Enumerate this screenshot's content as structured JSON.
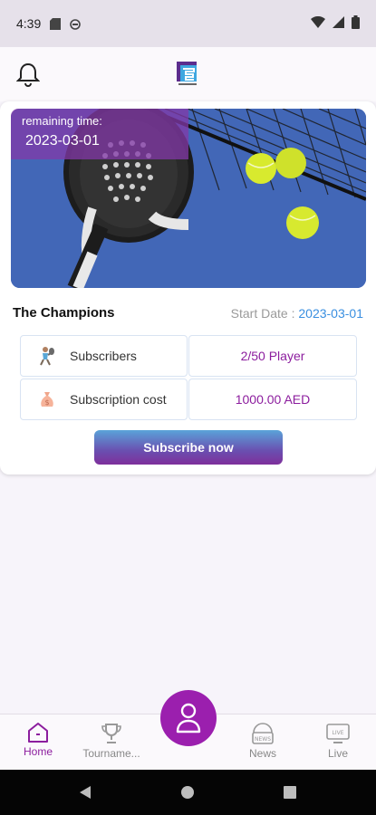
{
  "status_bar": {
    "time": "4:39"
  },
  "card": {
    "remaining_label": "remaining time:",
    "remaining_date": "2023-03-01",
    "title": "The Champions",
    "start_date_label": "Start Date :",
    "start_date_value": "2023-03-01",
    "rows": [
      {
        "icon": "player-icon",
        "label": "Subscribers",
        "value": "2/50  Player"
      },
      {
        "icon": "money-bag-icon",
        "label": "Subscription cost",
        "value": "1000.00 AED"
      }
    ],
    "subscribe_label": "Subscribe now"
  },
  "bottom_nav": {
    "items": [
      {
        "label": "Home",
        "icon": "home-icon",
        "active": true
      },
      {
        "label": "Tourname...",
        "icon": "trophy-icon",
        "active": false
      },
      {
        "label": "News",
        "icon": "news-icon",
        "active": false
      },
      {
        "label": "Live",
        "icon": "live-tv-icon",
        "active": false
      }
    ]
  },
  "colors": {
    "accent": "#8c1d9e",
    "start_date": "#3a8fe0",
    "hero_court": "#3a5fae"
  }
}
